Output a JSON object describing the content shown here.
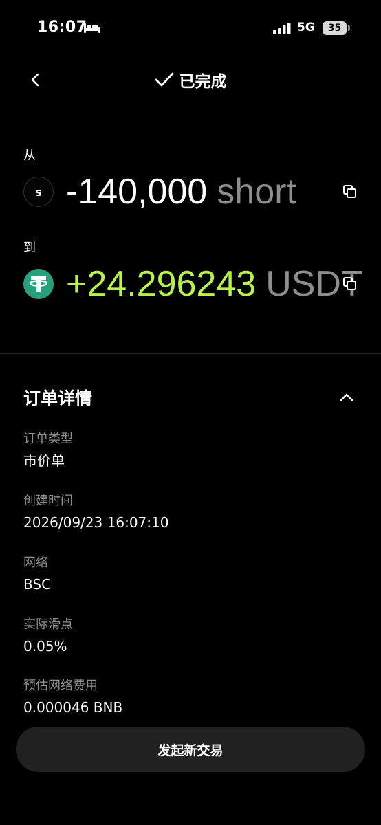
{
  "status_bar": {
    "time": "16:07",
    "sleep_icon": "bed-icon",
    "network": "5G",
    "battery": "35"
  },
  "header": {
    "back_icon": "chevron-left-icon",
    "status_icon": "check-icon",
    "status_text": "已完成"
  },
  "from": {
    "label": "从",
    "coin_icon_text": "s",
    "amount": "-140,000",
    "unit": "short",
    "copy_icon": "copy-icon"
  },
  "to": {
    "label": "到",
    "coin_icon": "tether-icon",
    "amount": "+24.296243",
    "unit": "USDT",
    "copy_icon": "copy-icon"
  },
  "details": {
    "title": "订单详情",
    "collapse_icon": "chevron-up-icon",
    "items": [
      {
        "label": "订单类型",
        "value": "市价单"
      },
      {
        "label": "创建时间",
        "value": "2026/09/23 16:07:10"
      },
      {
        "label": "网络",
        "value": "BSC"
      },
      {
        "label": "实际滑点",
        "value": "0.05%"
      },
      {
        "label": "预估网络费用",
        "value": "0.000046 BNB"
      }
    ]
  },
  "cta": {
    "label": "发起新交易"
  },
  "colors": {
    "background": "#000000",
    "positive": "#b7f34a",
    "muted": "#8d8d8d",
    "tether": "#26a17b",
    "button": "#212121"
  }
}
